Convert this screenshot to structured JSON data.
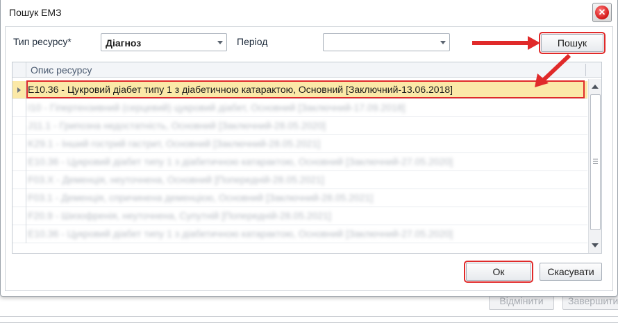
{
  "background": {
    "cancel_label": "Відмінити",
    "finish_label": "Завершити"
  },
  "dialog": {
    "title": "Пошук ЕМЗ",
    "close_icon": "close-icon",
    "filters": {
      "resource_type_label": "Тип ресурсу*",
      "resource_type_value": "Діагноз",
      "period_label": "Період",
      "period_value": ""
    },
    "search_button_label": "Пошук",
    "grid": {
      "column_header": "Опис ресурсу",
      "rows": [
        "E10.36 - Цукровий діабет типу 1 з діабетичною катарактою, Основний [Заключний-13.06.2018]",
        "I10 - Гіпертензивний (серцевий) цукровий діабет, Основний [Заключний-17.09.2018]",
        "J11.1 - Грипозна недостатність, Основний [Заключний-28.05.2020]",
        "K29.1 - Інший гострий гастрит, Основний [Заключний-28.05.2021]",
        "E10.36 - Цукровий діабет типу 1 з діабетичною катарактою, Основний [Заключний-27.05.2020]",
        "F03.X - Деменція, неуточнена, Основний [Попередній-28.05.2021]",
        "F03.1 - Деменція, спричинена деменцією, Основний [Заключний-28.05.2021]",
        "F20.9 - Шизофренія, неуточнена, Супутній [Попередній-28.05.2021]",
        "E10.36 - Цукровий діабет типу 1 з діабетичною катарактою, Основний [Заключний-27.05.2020]"
      ]
    },
    "ok_label": "Ок",
    "cancel_label": "Скасувати"
  },
  "colors": {
    "highlight": "#e02a2a",
    "selected_row": "#fbe9a8"
  }
}
